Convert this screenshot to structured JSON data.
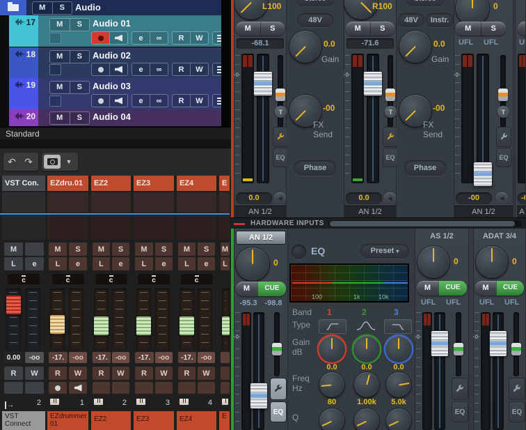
{
  "cubase": {
    "folder_row": {
      "mute": "M",
      "solo": "S",
      "name": "Audio"
    },
    "tracks": [
      {
        "num": "17",
        "mute": "M",
        "solo": "S",
        "name": "Audio 01",
        "e": "e",
        "link": "∞",
        "read": "R",
        "write": "W"
      },
      {
        "num": "18",
        "mute": "M",
        "solo": "S",
        "name": "Audio 02",
        "e": "e",
        "link": "∞",
        "read": "R",
        "write": "W"
      },
      {
        "num": "19",
        "mute": "M",
        "solo": "S",
        "name": "Audio 03",
        "e": "e",
        "link": "∞",
        "read": "R",
        "write": "W"
      },
      {
        "num": "20",
        "mute": "M",
        "solo": "S",
        "name": "Audio 04"
      }
    ],
    "preset_label": "Standard",
    "mixer": {
      "buttons": {
        "m": "M",
        "s": "S",
        "l": "L",
        "e": "e",
        "r": "R",
        "w": "W",
        "pan": "c"
      },
      "channels": [
        {
          "header": "VST Con.",
          "fader_db": "0.00",
          "meter_db": "-oo",
          "port": "2",
          "name": "VST Connect"
        },
        {
          "header": "EZdru.01",
          "fader_db": "-17.",
          "meter_db": "-oo",
          "port": "1",
          "name": "EZdrummer 01"
        },
        {
          "header": "EZ2",
          "fader_db": "-17.",
          "meter_db": "-oo",
          "port": "2",
          "name": "EZ2"
        },
        {
          "header": "EZ3",
          "fader_db": "-17.",
          "meter_db": "-oo",
          "port": "3",
          "name": "EZ3"
        },
        {
          "header": "EZ4",
          "fader_db": "-17.",
          "meter_db": "-oo",
          "port": "4",
          "name": "EZ4"
        },
        {
          "header": "E",
          "name": "E"
        }
      ]
    }
  },
  "totalmix": {
    "top": {
      "ch1": {
        "pan": "L100",
        "m": "M",
        "s": "S",
        "readout": "-68.1",
        "zero_mark": "·0·",
        "fader_db": "0.0",
        "name": "AN 1/2",
        "t": "T",
        "eq_tab": "EQ"
      },
      "settings1": {
        "stereo": "Stereo",
        "phantom": "48V",
        "gain_value": "0.0",
        "gain_label": "Gain",
        "fx_value": "-00",
        "fx_label": "FX Send",
        "phase": "Phase"
      },
      "ch2": {
        "pan": "R100",
        "m": "M",
        "s": "S",
        "readout": "-71.6",
        "zero_mark": "·0·",
        "fader_db": "0.0",
        "name": "AN 1/2",
        "t": "T",
        "eq_tab": "EQ"
      },
      "settings2": {
        "stereo": "Stereo",
        "phantom": "48V",
        "instrument": "Instr.",
        "gain_value": "0.0",
        "gain_label": "Gain",
        "fx_value": "-00",
        "fx_label": "FX Send",
        "phase": "Phase"
      },
      "ch3": {
        "volume": "0",
        "m": "M",
        "s": "S",
        "ufl_left": "UFL",
        "ufl_right": "UFL",
        "zero_mark": "·0·",
        "fader_db": "-00",
        "name": "AN 1/2",
        "t": "T",
        "eq_tab": "EQ"
      },
      "ch4": {
        "m": "M",
        "ufl": "UF",
        "zero_mark": "·0·",
        "fader_db": "-0",
        "name": "A"
      }
    },
    "divider": {
      "label": "HARDWARE INPUTS"
    },
    "bottom": {
      "an12": {
        "name": "AN 1/2",
        "volume": "0",
        "m": "M",
        "cue": "CUE",
        "readout_left": "-95.3",
        "readout_right": "-98.8",
        "zero_mark": "·0·",
        "eq_tab": "EQ"
      },
      "eq": {
        "title": "EQ",
        "preset": "Preset",
        "graph_ticks": [
          "100",
          "1k",
          "10k"
        ],
        "band_label": "Band",
        "bands": [
          "1",
          "2",
          "3"
        ],
        "type_label": "Type",
        "gain_label": "Gain",
        "gain_unit": "dB",
        "gain_values": [
          "0.0",
          "0.0",
          "0.0"
        ],
        "freq_label": "Freq",
        "freq_unit": "Hz",
        "freq_values": [
          "80",
          "1.00k",
          "5.0k"
        ],
        "q_label": "Q"
      },
      "as12": {
        "name": "AS 1/2",
        "volume": "0",
        "m": "M",
        "cue": "CUE",
        "ufl_left": "UFL",
        "ufl_right": "UFL",
        "zero_mark": "·0·",
        "eq_tab": "EQ"
      },
      "adat34": {
        "name": "ADAT 3/4",
        "volume": "0",
        "m": "M",
        "cue": "CUE",
        "ufl_left": "UFL",
        "ufl_right": "UFL",
        "zero_mark": "·0·",
        "eq_tab": "EQ"
      }
    }
  },
  "colors": {
    "track_cyan": "#44c3d7",
    "track_blue": "#3a57c4",
    "track_indigo": "#4a54e8",
    "track_purple": "#8940bd",
    "mixer_channel_orange": "#c04a2d",
    "value_yellow": "#e9b829",
    "band1_red": "#e04434",
    "band2_green": "#35a035",
    "band3_blue": "#4a82dc",
    "cue_green": "#3f9e43",
    "window_border_red": "#bf3a26",
    "window_border_green": "#2f9e34",
    "blue_line": "#4191da"
  }
}
